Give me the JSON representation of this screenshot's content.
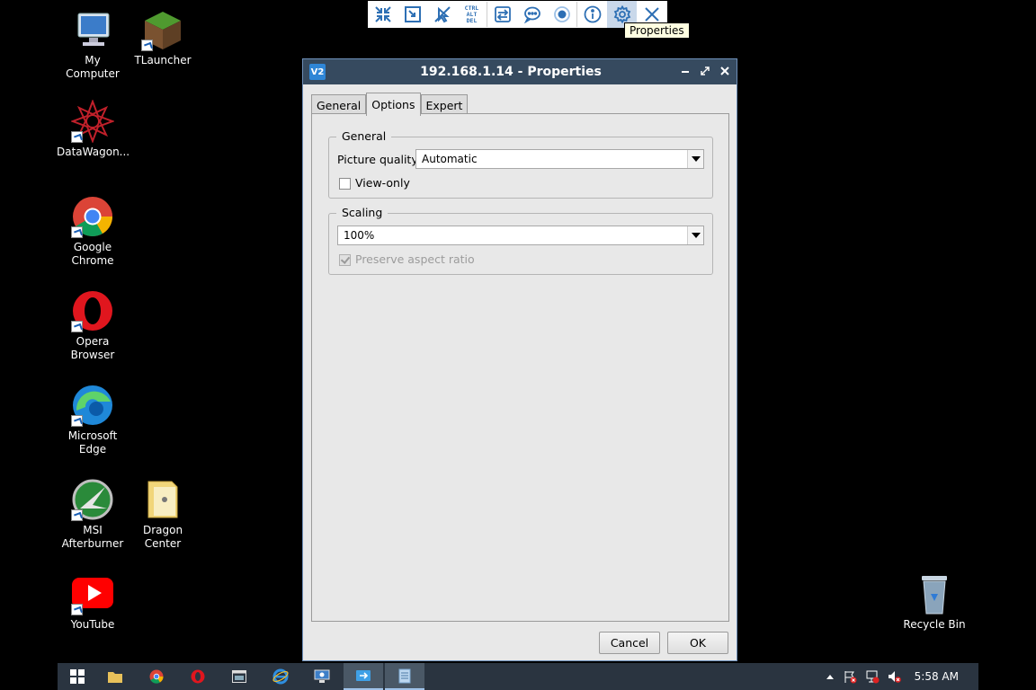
{
  "desktop": {
    "icons": [
      {
        "label": "My Computer"
      },
      {
        "label": "TLauncher"
      },
      {
        "label": "DataWagon..."
      },
      {
        "label": "Google Chrome"
      },
      {
        "label": "Opera Browser"
      },
      {
        "label": "Microsoft Edge"
      },
      {
        "label": "MSI Afterburner"
      },
      {
        "label": "Dragon Center"
      },
      {
        "label": "YouTube"
      },
      {
        "label": "Recycle Bin"
      }
    ]
  },
  "vnc_toolbar": {
    "cad_line1": "CTRL",
    "cad_line2": "ALT",
    "cad_line3": "DEL",
    "tooltip": "Properties"
  },
  "dialog": {
    "app_icon": "V2",
    "title": "192.168.1.14 - Properties",
    "tabs": [
      {
        "label": "General"
      },
      {
        "label": "Options"
      },
      {
        "label": "Expert"
      }
    ],
    "general_group": {
      "title": "General",
      "picture_quality_label": "Picture quality:",
      "picture_quality_value": "Automatic",
      "view_only_label": "View-only",
      "view_only_checked": false
    },
    "scaling_group": {
      "title": "Scaling",
      "scaling_value": "100%",
      "preserve_label": "Preserve aspect ratio",
      "preserve_checked": true
    },
    "buttons": {
      "cancel": "Cancel",
      "ok": "OK"
    }
  },
  "taskbar": {
    "clock": "5:58 AM"
  }
}
